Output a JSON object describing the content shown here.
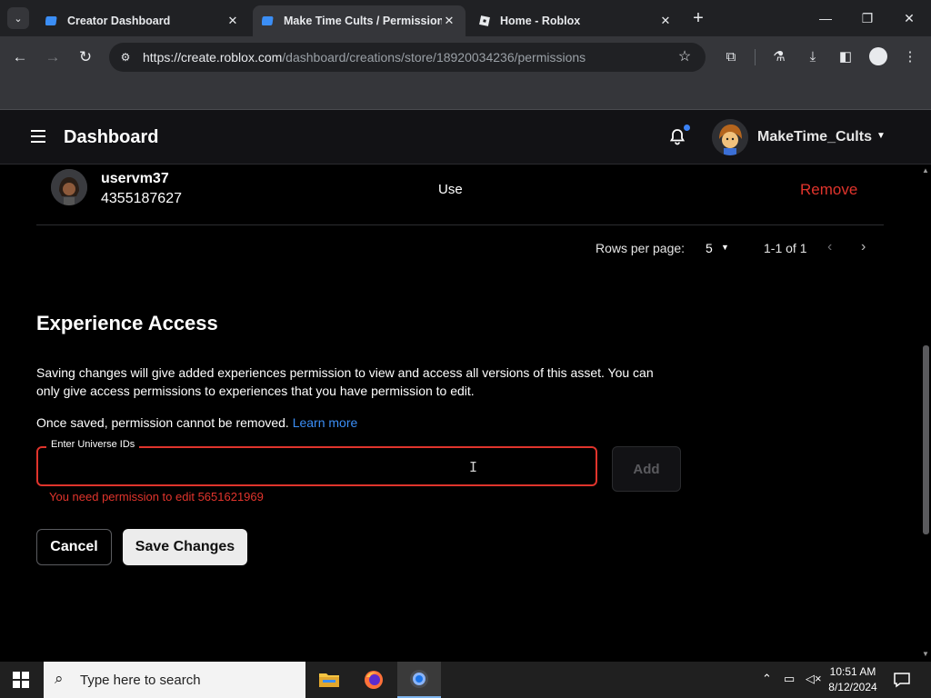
{
  "browser": {
    "tabs": [
      {
        "label": "Creator Dashboard",
        "active": false
      },
      {
        "label": "Make Time Cults / Permissions",
        "active": true
      },
      {
        "label": "Home - Roblox",
        "active": false
      }
    ],
    "url_host": "https://create.roblox.com",
    "url_path": "/dashboard/creations/store/18920034236/permissions"
  },
  "app": {
    "title": "Dashboard",
    "username": "MakeTime_Cults"
  },
  "permission_row": {
    "name": "uservm37",
    "user_id": "4355187627",
    "permission": "Use",
    "remove_label": "Remove"
  },
  "pagination": {
    "rows_per_page_label": "Rows per page:",
    "rows_per_page_value": "5",
    "range": "1-1 of 1"
  },
  "experience_access": {
    "title": "Experience Access",
    "description": "Saving changes will give added experiences permission to view and access all versions of this asset. You can only give access permissions to experiences that you have permission to edit.",
    "note": "Once saved, permission cannot be removed.",
    "learn_more": "Learn more",
    "field_label": "Enter Universe IDs",
    "field_value": "",
    "add_label": "Add",
    "error": "You need permission to edit 5651621969"
  },
  "actions": {
    "cancel": "Cancel",
    "save": "Save Changes"
  },
  "taskbar": {
    "search_placeholder": "Type here to search",
    "time": "10:51 AM",
    "date": "8/12/2024"
  },
  "colors": {
    "accent_blue": "#3b8ef6",
    "error_red": "#e0342c"
  }
}
